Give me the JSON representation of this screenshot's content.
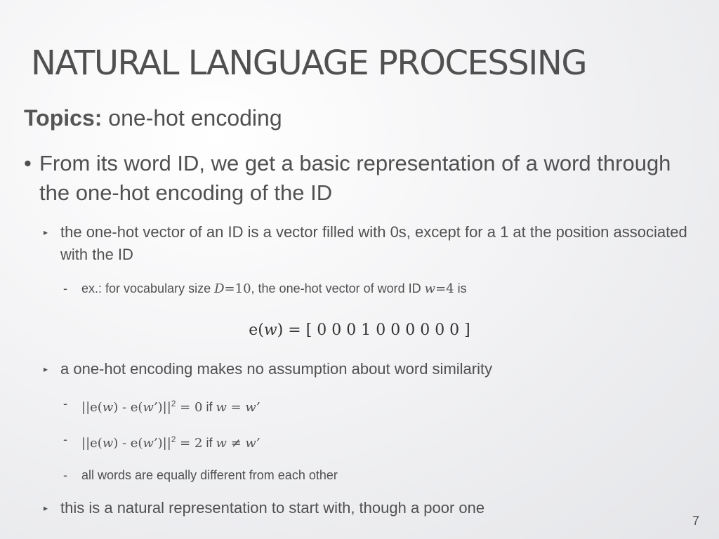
{
  "slide": {
    "title": "NATURAL LANGUAGE PROCESSING",
    "topics_label": "Topics:",
    "topics_text": "one-hot encoding",
    "bullet1": "From its word ID, we get a basic representation of a word through the one-hot encoding of the ID",
    "sub1": "the one-hot vector of an ID is a vector filled with 0s, except for a 1 at the position associated with the ID",
    "ex_prefix": "ex.:  for vocabulary size ",
    "ex_D": "D",
    "ex_eq1": "=10",
    "ex_mid": ", the one-hot vector of word ID ",
    "ex_w": "w",
    "ex_eq2": "=4",
    "ex_suffix": " is",
    "equation_lhs": "e(",
    "equation_w": "w",
    "equation_rhs": ") = [ 0 0 0 1 0 0 0 0 0 0 ]",
    "sub2": "a one-hot encoding makes no assumption about word similarity",
    "item1_a": "||e(",
    "item1_b": "w",
    "item1_c": ") - e(",
    "item1_d": "w’",
    "item1_e": ")||",
    "item1_sup": "2",
    "item1_f": " = 0",
    "item1_g": " if ",
    "item1_h": "w",
    "item1_i": " = ",
    "item1_j": "w’",
    "item2_f": " = 2",
    "item2_i": " ≠ ",
    "item3": "all words are equally different from each other",
    "sub3": "this is a natural representation to start with, though a poor one",
    "page_number": "7",
    "bullet_glyph": "•",
    "sub_glyph": "▸",
    "dash_glyph": "-"
  }
}
